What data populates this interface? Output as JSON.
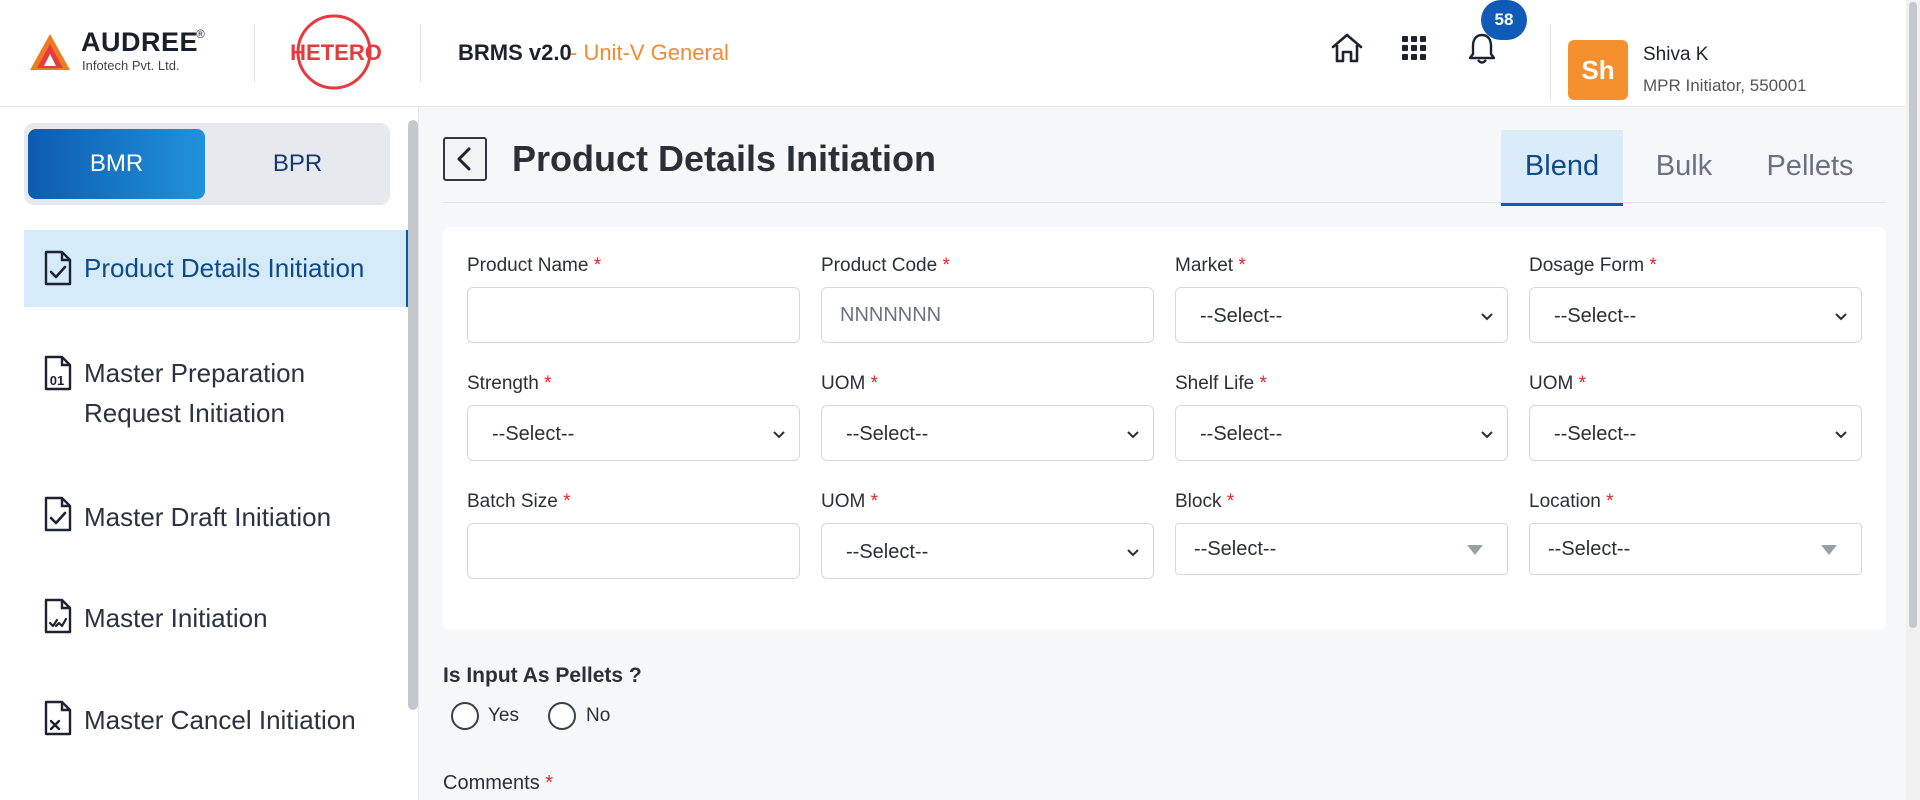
{
  "header": {
    "brand_name": "AUDREE",
    "brand_reg": "®",
    "brand_sub": "Infotech Pvt. Ltd.",
    "client_logo_text": "HETERO",
    "app_title": "BRMS v2.0",
    "app_unit": " - Unit-V General",
    "notification_count": "58",
    "user": {
      "initials": "Sh",
      "name": "Shiva K",
      "role": "MPR Initiator, 550001"
    },
    "colors": {
      "accent_orange": "#f28a2e",
      "brand_blue": "#0f5cb8",
      "logo_red": "#e63a3f"
    }
  },
  "sidebar": {
    "toggle": {
      "left": "BMR",
      "right": "BPR",
      "selected": "BMR"
    },
    "items": [
      {
        "label": "Product Details Initiation",
        "icon": "file-check-icon",
        "active": true
      },
      {
        "label": "Master Preparation",
        "label2": "Request Initiation",
        "icon": "file-binary-icon",
        "active": false
      },
      {
        "label": "Master Draft Initiation",
        "icon": "file-check-icon",
        "active": false
      },
      {
        "label": "Master Initiation",
        "icon": "file-signature-icon",
        "active": false
      },
      {
        "label": "Master Cancel Initiation",
        "icon": "file-cancel-icon",
        "active": false
      }
    ]
  },
  "main": {
    "title": "Product Details Initiation",
    "tabs": [
      {
        "label": "Blend",
        "active": true
      },
      {
        "label": "Bulk",
        "active": false
      },
      {
        "label": "Pellets",
        "active": false
      }
    ],
    "form": {
      "required_mark": "*",
      "product_name": {
        "label": "Product Name",
        "value": ""
      },
      "product_code": {
        "label": "Product Code",
        "placeholder": "NNNNNNN"
      },
      "market": {
        "label": "Market",
        "value": "--Select--"
      },
      "dosage_form": {
        "label": "Dosage Form",
        "value": "--Select--"
      },
      "strength": {
        "label": "Strength",
        "value": "--Select--"
      },
      "strength_uom": {
        "label": "UOM",
        "value": "--Select--"
      },
      "shelf_life": {
        "label": "Shelf Life",
        "value": "--Select--"
      },
      "shelf_life_uom": {
        "label": "UOM",
        "value": "--Select--"
      },
      "batch_size": {
        "label": "Batch Size",
        "value": ""
      },
      "batch_uom": {
        "label": "UOM",
        "value": "--Select--"
      },
      "block": {
        "label": "Block",
        "value": "--Select--"
      },
      "location": {
        "label": "Location",
        "value": "--Select--"
      }
    },
    "pellets_question": "Is Input As Pellets ?",
    "pellets_options": [
      "Yes",
      "No"
    ],
    "comments_label": "Comments"
  }
}
